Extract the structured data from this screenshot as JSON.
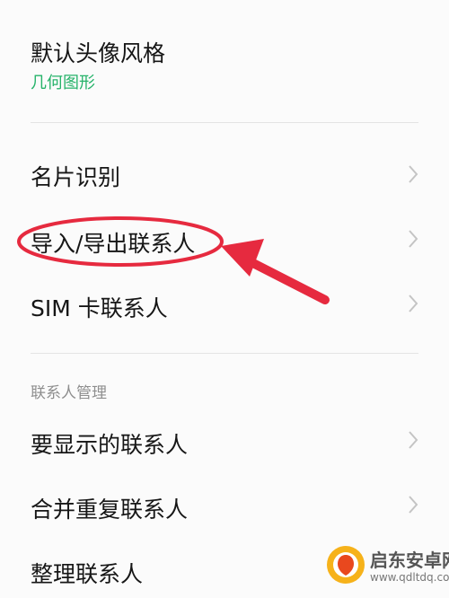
{
  "settings": {
    "avatar_style": {
      "title": "默认头像风格",
      "value": "几何图形"
    },
    "items": [
      {
        "label": "名片识别"
      },
      {
        "label": "导入/导出联系人"
      },
      {
        "label": "SIM 卡联系人"
      }
    ],
    "contacts_section": {
      "header": "联系人管理",
      "items": [
        {
          "label": "要显示的联系人"
        },
        {
          "label": "合并重复联系人"
        },
        {
          "label": "整理联系人"
        }
      ]
    }
  },
  "colors": {
    "accent_green": "#26b36a",
    "annotation_red": "#e62a3f",
    "text": "#161616",
    "muted": "#8e8e8e"
  },
  "icons": {
    "row_chevron": "chevron-right-icon"
  },
  "watermark": {
    "brand": "启东安卓网",
    "url": "www.qdltdq.com"
  }
}
